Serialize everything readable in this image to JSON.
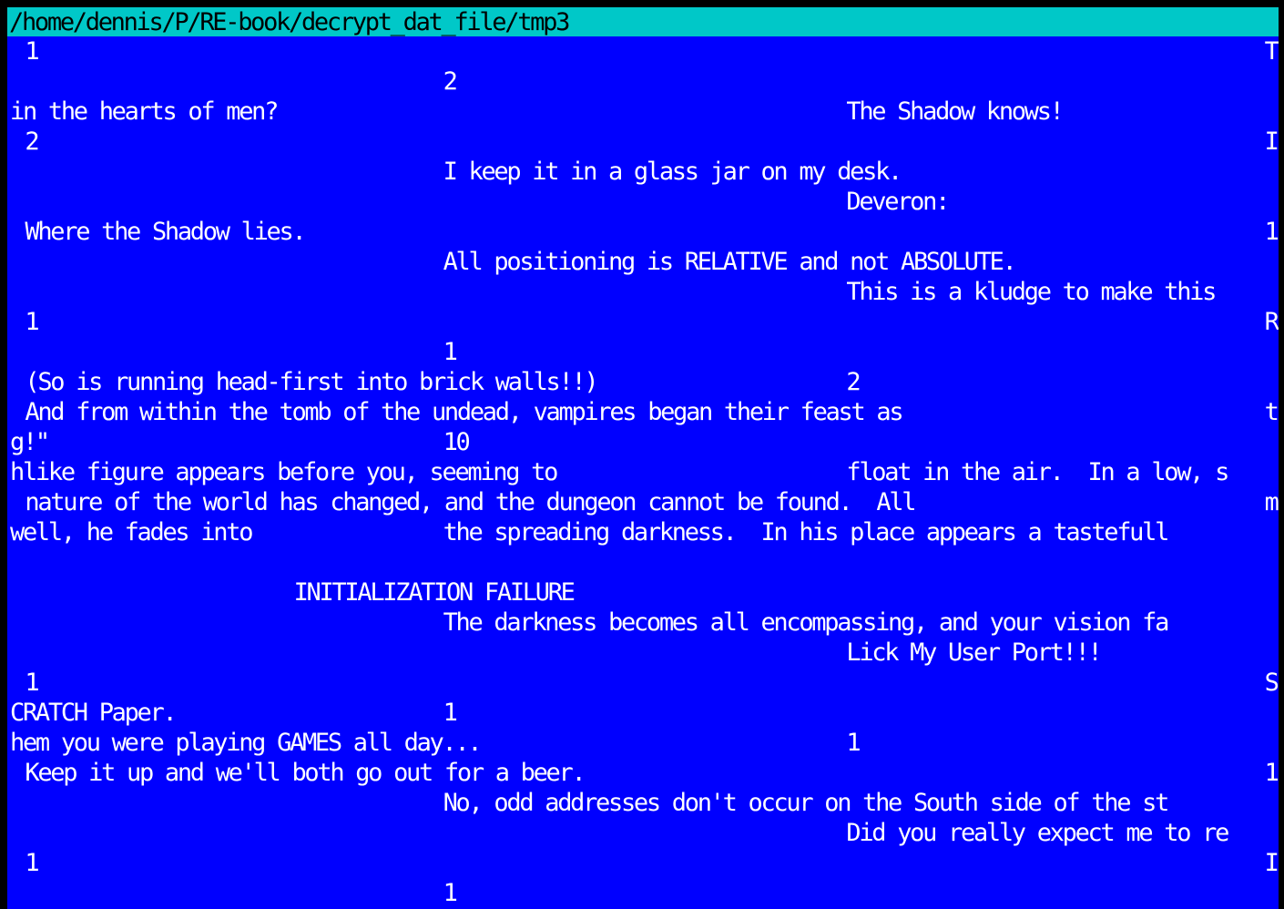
{
  "window": {
    "title": "/home/dennis/P/RE-book/decrypt_dat_file/tmp3"
  },
  "colors": {
    "background": "#0000ff",
    "titlebar": "#00c8c8",
    "text": "#ffffff",
    "title_text": "#000000"
  },
  "lines": [
    [
      {
        "col": 1,
        "text": "1"
      },
      {
        "col": 84,
        "text": "The"
      }
    ],
    [
      {
        "col": 29,
        "text": "2"
      }
    ],
    [
      {
        "col": 0,
        "text": "in the hearts of men?"
      },
      {
        "col": 56,
        "text": "The Shadow knows!"
      }
    ],
    [
      {
        "col": 1,
        "text": "2"
      },
      {
        "col": 84,
        "text": "I h"
      }
    ],
    [
      {
        "col": 29,
        "text": "I keep it in a glass jar on my desk."
      }
    ],
    [
      {
        "col": 56,
        "text": "Deveron:"
      }
    ],
    [
      {
        "col": 1,
        "text": "Where the Shadow lies."
      },
      {
        "col": 84,
        "text": "1"
      }
    ],
    [
      {
        "col": 29,
        "text": "All positioning is RELATIVE and not ABSOLUTE."
      }
    ],
    [
      {
        "col": 56,
        "text": "This is a kludge to make this"
      }
    ],
    [
      {
        "col": 1,
        "text": "1"
      },
      {
        "col": 84,
        "text": "Rel"
      }
    ],
    [
      {
        "col": 29,
        "text": "1"
      }
    ],
    [
      {
        "col": 1,
        "text": "(So is running head-first into brick walls!!)"
      },
      {
        "col": 56,
        "text": "2"
      }
    ],
    [
      {
        "col": 1,
        "text": "And from within the tomb of the undead, vampires began their feast as"
      },
      {
        "col": 84,
        "text": "tor"
      }
    ],
    [
      {
        "col": 0,
        "text": "g!\""
      },
      {
        "col": 29,
        "text": "10"
      }
    ],
    [
      {
        "col": 0,
        "text": "hlike figure appears before you, seeming to"
      },
      {
        "col": 56,
        "text": "float in the air.  In a low, s"
      }
    ],
    [
      {
        "col": 1,
        "text": "nature of the world has changed, and the dungeon cannot be found.  All"
      },
      {
        "col": 84,
        "text": "mus"
      }
    ],
    [
      {
        "col": 0,
        "text": "well, he fades into"
      },
      {
        "col": 29,
        "text": "the spreading darkness.  In his place appears a tastefull"
      }
    ],
    [],
    [
      {
        "col": 19,
        "text": "INITIALIZATION FAILURE"
      }
    ],
    [
      {
        "col": 29,
        "text": "The darkness becomes all encompassing, and your vision fa"
      }
    ],
    [
      {
        "col": 56,
        "text": "Lick My User Port!!!"
      }
    ],
    [
      {
        "col": 1,
        "text": "1"
      },
      {
        "col": 84,
        "text": "So"
      }
    ],
    [
      {
        "col": 0,
        "text": "CRATCH Paper."
      },
      {
        "col": 29,
        "text": "1"
      }
    ],
    [
      {
        "col": 0,
        "text": "hem you were playing GAMES all day..."
      },
      {
        "col": 56,
        "text": "1"
      }
    ],
    [
      {
        "col": 1,
        "text": "Keep it up and we'll both go out for a beer."
      },
      {
        "col": 84,
        "text": "1"
      }
    ],
    [
      {
        "col": 29,
        "text": "No, odd addresses don't occur on the South side of the st"
      }
    ],
    [
      {
        "col": 56,
        "text": "Did you really expect me to re"
      }
    ],
    [
      {
        "col": 1,
        "text": "1"
      },
      {
        "col": 84,
        "text": "In"
      }
    ],
    [
      {
        "col": 29,
        "text": "1"
      }
    ]
  ]
}
